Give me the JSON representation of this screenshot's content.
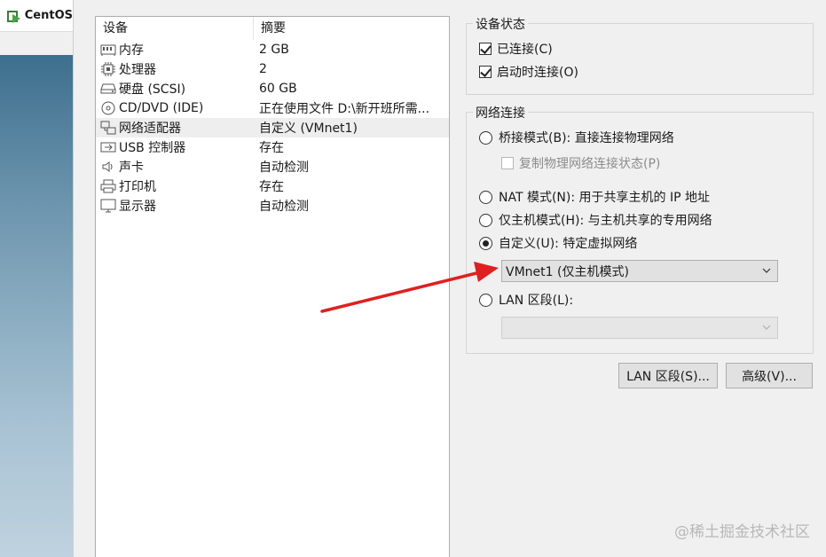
{
  "window": {
    "tab_label": "CentOS"
  },
  "device_list": {
    "columns": [
      "设备",
      "摘要"
    ],
    "rows": [
      {
        "icon": "memory-icon",
        "name": "内存",
        "summary": "2 GB"
      },
      {
        "icon": "processor-icon",
        "name": "处理器",
        "summary": "2"
      },
      {
        "icon": "harddisk-icon",
        "name": "硬盘 (SCSI)",
        "summary": "60 GB"
      },
      {
        "icon": "cd-dvd-icon",
        "name": "CD/DVD (IDE)",
        "summary": "正在使用文件 D:\\新开班所需..."
      },
      {
        "icon": "network-adapter-icon",
        "name": "网络适配器",
        "summary": "自定义 (VMnet1)",
        "selected": true
      },
      {
        "icon": "usb-icon",
        "name": "USB 控制器",
        "summary": "存在"
      },
      {
        "icon": "sound-icon",
        "name": "声卡",
        "summary": "自动检测"
      },
      {
        "icon": "printer-icon",
        "name": "打印机",
        "summary": "存在"
      },
      {
        "icon": "display-icon",
        "name": "显示器",
        "summary": "自动检测"
      }
    ]
  },
  "device_status": {
    "title": "设备状态",
    "connected_label": "已连接(C)",
    "connected": true,
    "connect_on_start_label": "启动时连接(O)",
    "connect_on_start": true
  },
  "network": {
    "title": "网络连接",
    "bridged_label": "桥接模式(B): 直接连接物理网络",
    "replicate_label": "复制物理网络连接状态(P)",
    "nat_label": "NAT 模式(N): 用于共享主机的 IP 地址",
    "hostonly_label": "仅主机模式(H): 与主机共享的专用网络",
    "custom_label": "自定义(U): 特定虚拟网络",
    "selected": "custom",
    "custom_select_value": "VMnet1 (仅主机模式)",
    "lan_label": "LAN 区段(L):",
    "lan_select_value": ""
  },
  "buttons": {
    "lan_segments": "LAN 区段(S)...",
    "advanced": "高级(V)..."
  },
  "watermark": "@稀土掘金技术社区",
  "colors": {
    "arrow": "#e02020",
    "selected_row": "#eeeeee"
  }
}
